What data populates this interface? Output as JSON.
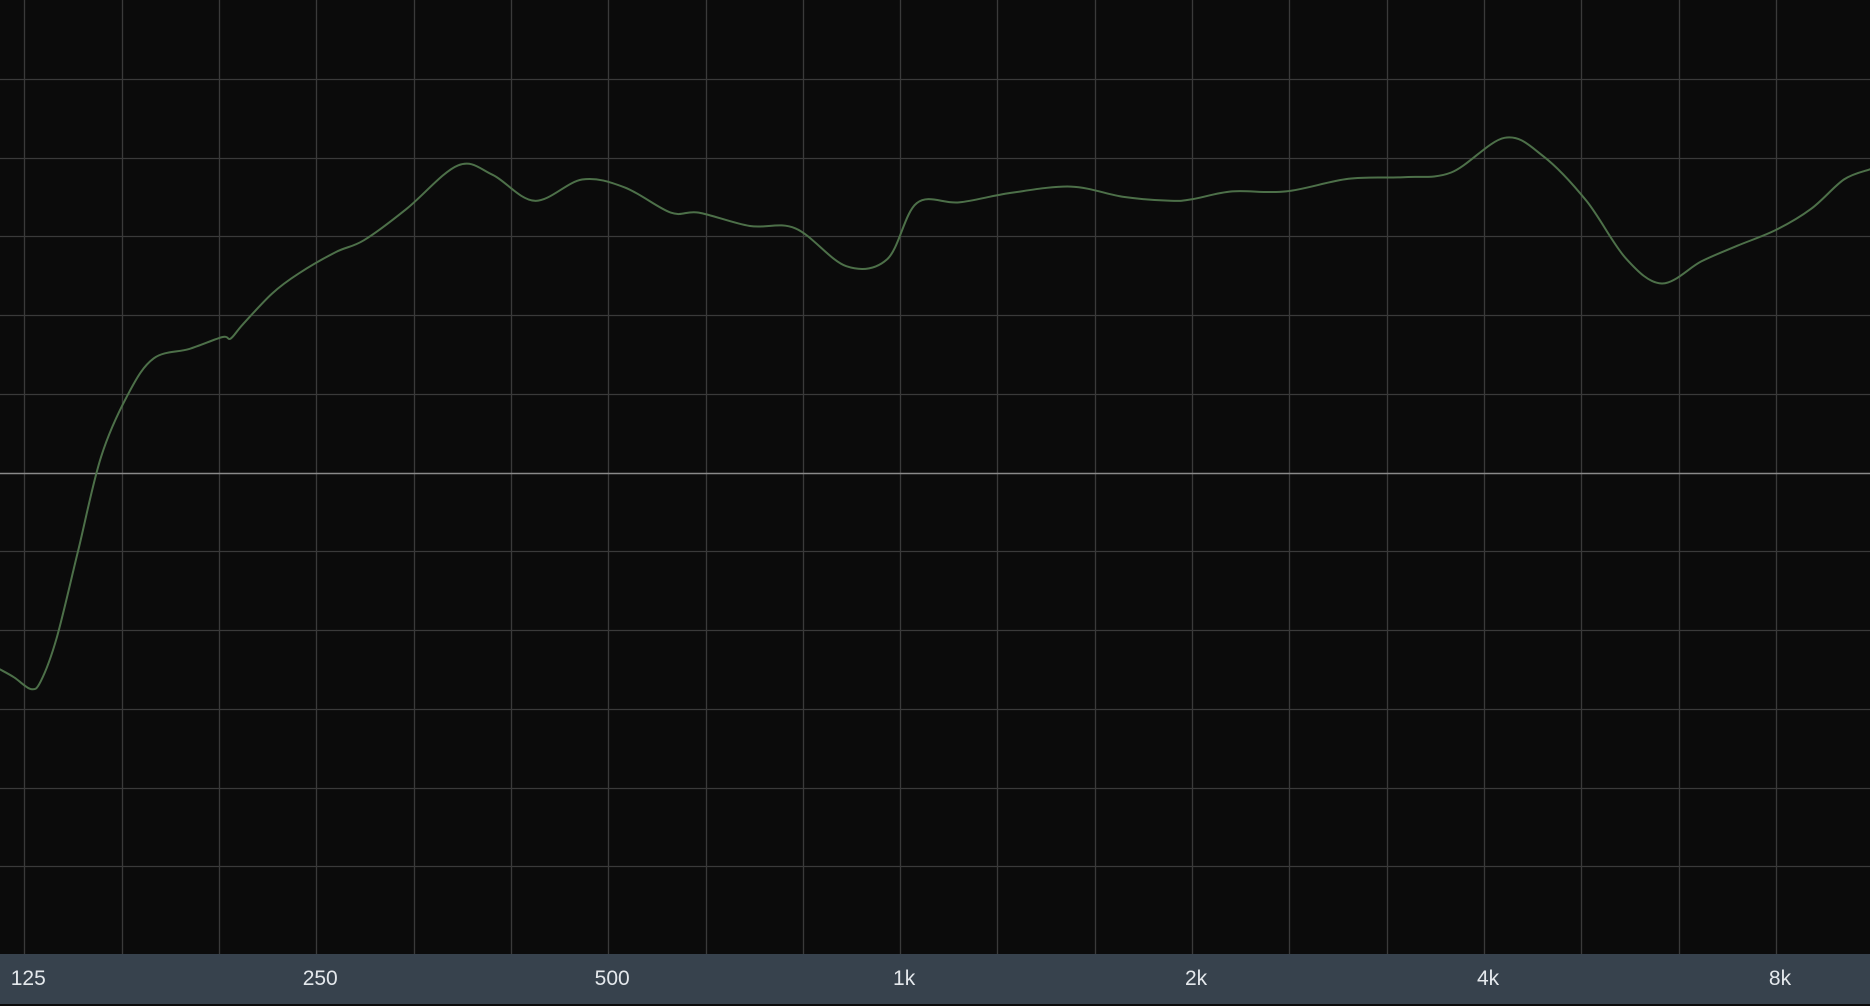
{
  "chart_data": {
    "type": "line",
    "title": "",
    "xlabel": "",
    "ylabel": "",
    "x_scale": "log",
    "xlim": [
      118,
      10000
    ],
    "ylim": [
      -6,
      6
    ],
    "grid": true,
    "legend": "none",
    "x_tick_labels": [
      {
        "value": 125,
        "label": "125"
      },
      {
        "value": 250,
        "label": "250"
      },
      {
        "value": 500,
        "label": "500"
      },
      {
        "value": 1000,
        "label": "1k"
      },
      {
        "value": 2000,
        "label": "2k"
      },
      {
        "value": 4000,
        "label": "4k"
      },
      {
        "value": 8000,
        "label": "8k"
      }
    ],
    "x_gridlines": [
      125,
      157.5,
      198.4,
      250,
      315,
      396.9,
      500,
      630,
      793.7,
      1000,
      1260,
      1587,
      2000,
      2520,
      3175,
      4000,
      5040,
      6350,
      8000
    ],
    "y_gridlines": [
      -5,
      -4,
      -3,
      -2,
      -1,
      0,
      1,
      2,
      3,
      4,
      5
    ],
    "reference_line": 0,
    "series": [
      {
        "color": "#4d7049",
        "x": [
          118,
          122,
          127,
          130,
          135,
          142,
          150,
          160,
          170,
          185,
          200,
          204,
          210,
          225,
          240,
          262,
          280,
          310,
          350,
          380,
          420,
          470,
          520,
          580,
          620,
          700,
          780,
          880,
          970,
          1040,
          1150,
          1300,
          1500,
          1700,
          1900,
          2000,
          2200,
          2500,
          2900,
          3300,
          3700,
          4200,
          4600,
          5100,
          5600,
          6100,
          6700,
          7300,
          8000,
          8700,
          9400,
          10000
        ],
        "y": [
          -2.5,
          -2.6,
          -2.75,
          -2.65,
          -2.1,
          -1.0,
          0.2,
          1.0,
          1.45,
          1.57,
          1.72,
          1.7,
          1.88,
          2.27,
          2.53,
          2.8,
          2.95,
          3.35,
          3.9,
          3.78,
          3.45,
          3.72,
          3.62,
          3.3,
          3.3,
          3.13,
          3.1,
          2.62,
          2.71,
          3.42,
          3.43,
          3.55,
          3.63,
          3.5,
          3.45,
          3.47,
          3.57,
          3.57,
          3.73,
          3.75,
          3.81,
          4.25,
          4.02,
          3.45,
          2.72,
          2.4,
          2.68,
          2.88,
          3.08,
          3.35,
          3.72,
          3.85
        ]
      }
    ]
  }
}
